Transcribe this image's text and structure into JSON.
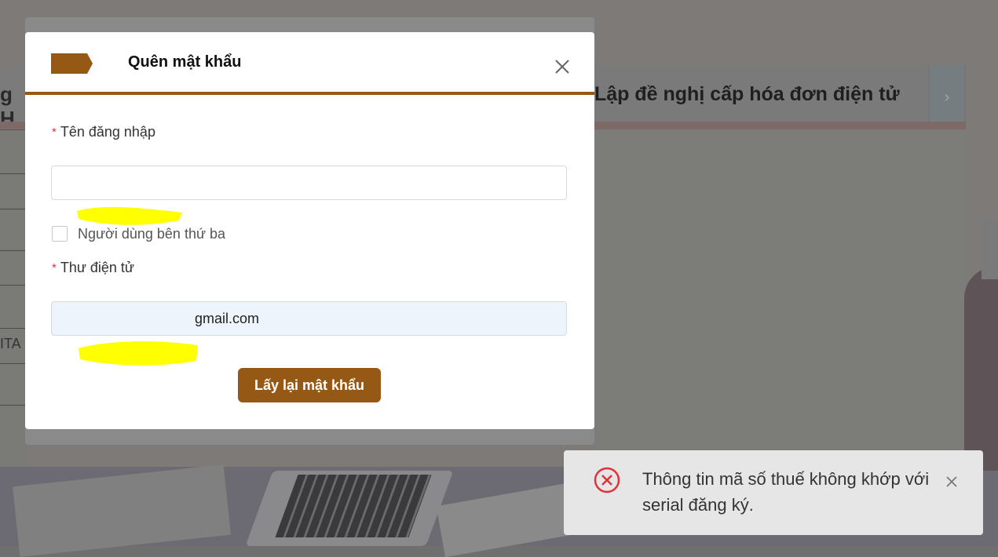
{
  "background": {
    "tab_left_partial": "g H",
    "tab_right_label": "Lập đề nghị cấp hóa đơn điện tử",
    "tab_next_arrow": "›",
    "left_panel_text": "ITA"
  },
  "modal": {
    "title": "Quên mật khẩu",
    "header_icon": "arrow-tag-icon",
    "accent_color": "#955815",
    "fields": {
      "username": {
        "required_mark": "*",
        "label": "Tên đăng nhập",
        "value": ""
      },
      "third_party": {
        "label": "Người dùng bên thứ ba",
        "checked": false
      },
      "email": {
        "required_mark": "*",
        "label": "Thư điện tử",
        "value_visible": "gmail.com"
      }
    },
    "submit_label": "Lấy lại mật khẩu"
  },
  "toast": {
    "icon": "error-circle-icon",
    "message": "Thông tin mã số thuế không khớp với serial đăng ký.",
    "error_color": "#e0303a"
  }
}
